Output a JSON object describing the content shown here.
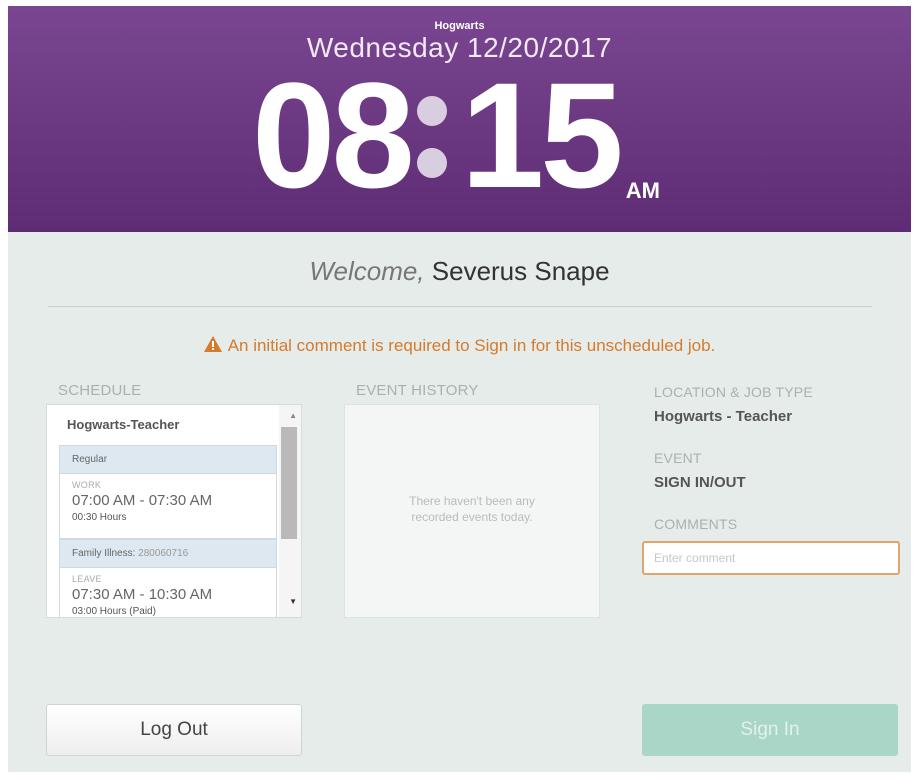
{
  "header": {
    "organization": "Hogwarts",
    "date": "Wednesday 12/20/2017",
    "time_hours": "08",
    "time_minutes": "15",
    "ampm": "AM"
  },
  "welcome": {
    "prefix": "Welcome,",
    "name": "Severus Snape"
  },
  "warning": {
    "icon": "warning-triangle-icon",
    "text": "An initial comment is required to Sign in for this unscheduled job."
  },
  "schedule": {
    "title": "SCHEDULE",
    "job": "Hogwarts-Teacher",
    "blocks": [
      {
        "band": "Regular",
        "code": "",
        "type": "WORK",
        "time": "07:00 AM - 07:30 AM",
        "hours": "00:30 Hours"
      },
      {
        "band": "Family Illness:",
        "code": "280060716",
        "type": "LEAVE",
        "time": "07:30 AM - 10:30 AM",
        "hours": "03:00 Hours (Paid)"
      }
    ]
  },
  "history": {
    "title": "EVENT HISTORY",
    "empty_line1": "There haven't been any",
    "empty_line2": "recorded events today."
  },
  "details": {
    "location_label": "LOCATION & JOB TYPE",
    "location_value": "Hogwarts - Teacher",
    "event_label": "EVENT",
    "event_value": "SIGN IN/OUT",
    "comments_label": "COMMENTS",
    "comment_placeholder": "Enter comment",
    "comment_value": ""
  },
  "buttons": {
    "logout": "Log Out",
    "signin": "Sign In"
  },
  "colors": {
    "header_purple": "#6b3683",
    "warning_orange": "#d67a2c",
    "signin_disabled": "#a9d6c7"
  }
}
